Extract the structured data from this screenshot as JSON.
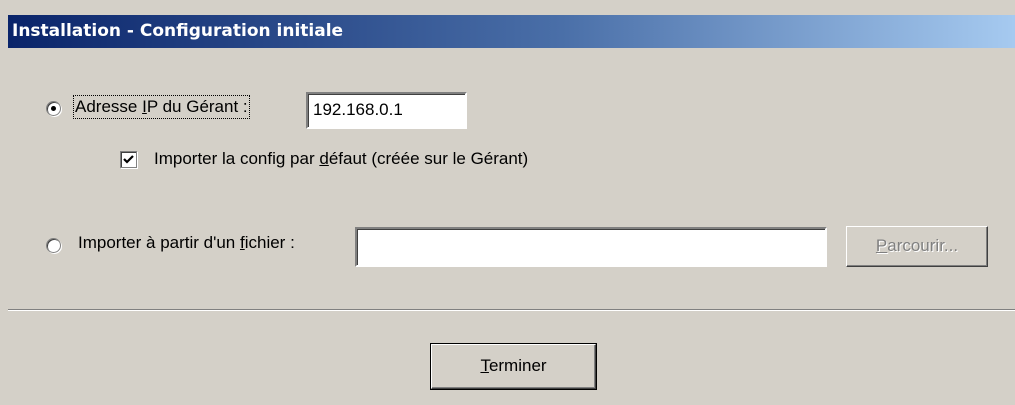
{
  "window": {
    "title": "Installation - Configuration initiale"
  },
  "options": {
    "manager_ip": {
      "label_before": "Adresse ",
      "label_mnemonic": "I",
      "label_after": "P du Gérant :",
      "value": "192.168.0.1",
      "selected": true
    },
    "import_default": {
      "label_before": "Importer la config par ",
      "label_mnemonic": "d",
      "label_after": "éfaut (créée sur le Gérant)",
      "checked": true
    },
    "import_file": {
      "label_before": "Importer à partir d'un ",
      "label_mnemonic": "f",
      "label_after": "ichier :",
      "value": "",
      "selected": false
    }
  },
  "buttons": {
    "browse": {
      "mnemonic": "P",
      "rest": "arcourir...",
      "enabled": false
    },
    "finish": {
      "mnemonic": "T",
      "rest": "erminer"
    }
  }
}
